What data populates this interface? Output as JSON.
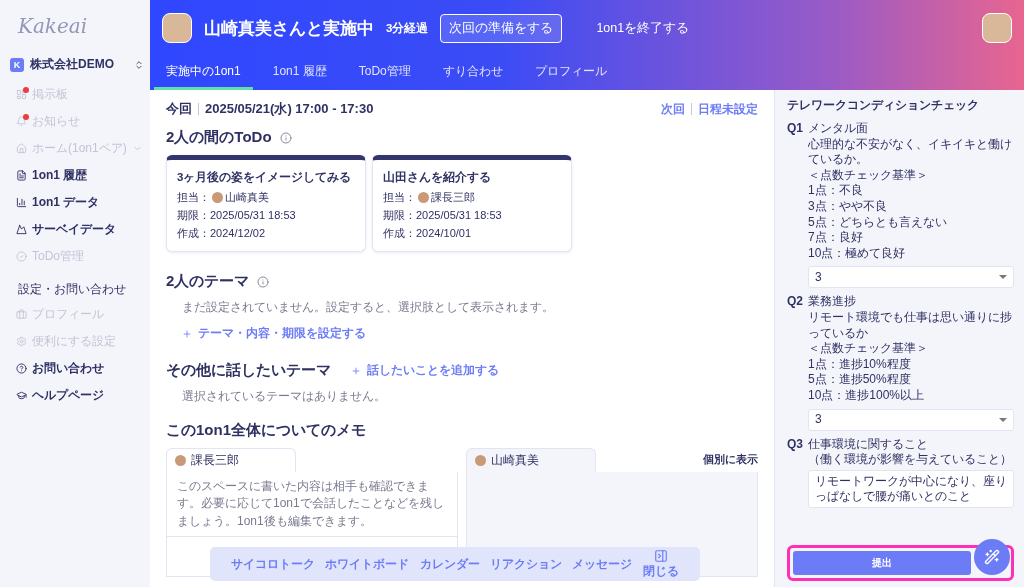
{
  "sidebar": {
    "logo": "Kakeai",
    "company": "株式会社DEMO",
    "company_initial": "K",
    "items": [
      {
        "label": "掲示板",
        "disabled": true,
        "badge": true
      },
      {
        "label": "お知らせ",
        "disabled": true,
        "badge": true
      },
      {
        "label": "ホーム(1on1ペア)",
        "disabled": true,
        "badge": false,
        "expandable": true
      },
      {
        "label": "1on1 履歴",
        "disabled": false,
        "badge": false
      },
      {
        "label": "1on1 データ",
        "disabled": false,
        "badge": false
      },
      {
        "label": "サーベイデータ",
        "disabled": false,
        "badge": false
      },
      {
        "label": "ToDo管理",
        "disabled": true,
        "badge": false
      }
    ],
    "section_title": "設定・お問い合わせ",
    "section_items": [
      {
        "label": "プロフィール",
        "disabled": true,
        "badge": false
      },
      {
        "label": "便利にする設定",
        "disabled": true,
        "badge": false
      },
      {
        "label": "お問い合わせ",
        "disabled": false,
        "badge": false
      },
      {
        "label": "ヘルプページ",
        "disabled": false,
        "badge": false
      }
    ]
  },
  "header": {
    "title": "山崎真美さんと実施中",
    "elapsed": "3分経過",
    "prepare_button": "次回の準備をする",
    "end_button": "1on1を終了する",
    "tabs": [
      {
        "label": "実施中の1on1",
        "selected": true
      },
      {
        "label": "1on1 履歴",
        "selected": false
      },
      {
        "label": "ToDo管理",
        "selected": false
      },
      {
        "label": "すり合わせ",
        "selected": false
      },
      {
        "label": "プロフィール",
        "selected": false
      }
    ]
  },
  "schedule": {
    "current_label": "今回",
    "current": "2025/05/21(水)  17:00 - 17:30",
    "next_label": "次回",
    "next": "日程未設定"
  },
  "todo": {
    "title": "2人の間のToDo",
    "cards": [
      {
        "title": "3ヶ月後の姿をイメージしてみる",
        "assignee_label": "担当：",
        "assignee": "山崎真美",
        "due": "期限：2025/05/31 18:53",
        "created": "作成：2024/12/02"
      },
      {
        "title": "山田さんを紹介する",
        "assignee_label": "担当：",
        "assignee": "課長三郎",
        "due": "期限：2025/05/31 18:53",
        "created": "作成：2024/10/01"
      }
    ]
  },
  "themes": {
    "title": "2人のテーマ",
    "empty": "まだ設定されていません。設定すると、選択肢として表示されます。",
    "add_link": "テーマ・内容・期限を設定する"
  },
  "other_themes": {
    "title": "その他に話したいテーマ",
    "add_link": "話したいことを追加する",
    "empty": "選択されているテーマはありません。"
  },
  "memo": {
    "title": "この1on1全体についてのメモ",
    "show_separately": "個別に表示",
    "panels": [
      {
        "author": "課長三郎",
        "placeholder": "このスペースに書いた内容は相手も確認できます。必要に応じて1on1で会話したことなどを残しましょう。1on1後も編集できます。"
      },
      {
        "author": "山崎真美"
      }
    ]
  },
  "toolbar": {
    "items": [
      "サイコロトーク",
      "ホワイトボード",
      "カレンダー",
      "リアクション",
      "メッセージ"
    ],
    "close": "閉じる"
  },
  "survey": {
    "title": "テレワークコンディションチェック",
    "questions": [
      {
        "number": "Q1",
        "kind": "select",
        "lines": [
          "メンタル面",
          "心理的な不安がなく、イキイキと働けているか。",
          "＜点数チェック基準＞",
          "1点：不良",
          "3点：やや不良",
          "5点：どちらとも言えない",
          "7点：良好",
          "10点：極めて良好"
        ],
        "value": "3"
      },
      {
        "number": "Q2",
        "kind": "select",
        "lines": [
          "業務進捗",
          "リモート環境でも仕事は思い通りに捗っているか",
          "＜点数チェック基準＞",
          "1点：進捗10%程度",
          "5点：進捗50%程度",
          "10点：進捗100%以上"
        ],
        "value": "3"
      },
      {
        "number": "Q3",
        "kind": "text",
        "lines": [
          "仕事環境に関すること",
          "（働く環境が影響を与えていること）"
        ],
        "value": "リモートワークが中心になり、座りっぱなしで腰が痛いとのこと"
      }
    ],
    "submit": "提出"
  }
}
